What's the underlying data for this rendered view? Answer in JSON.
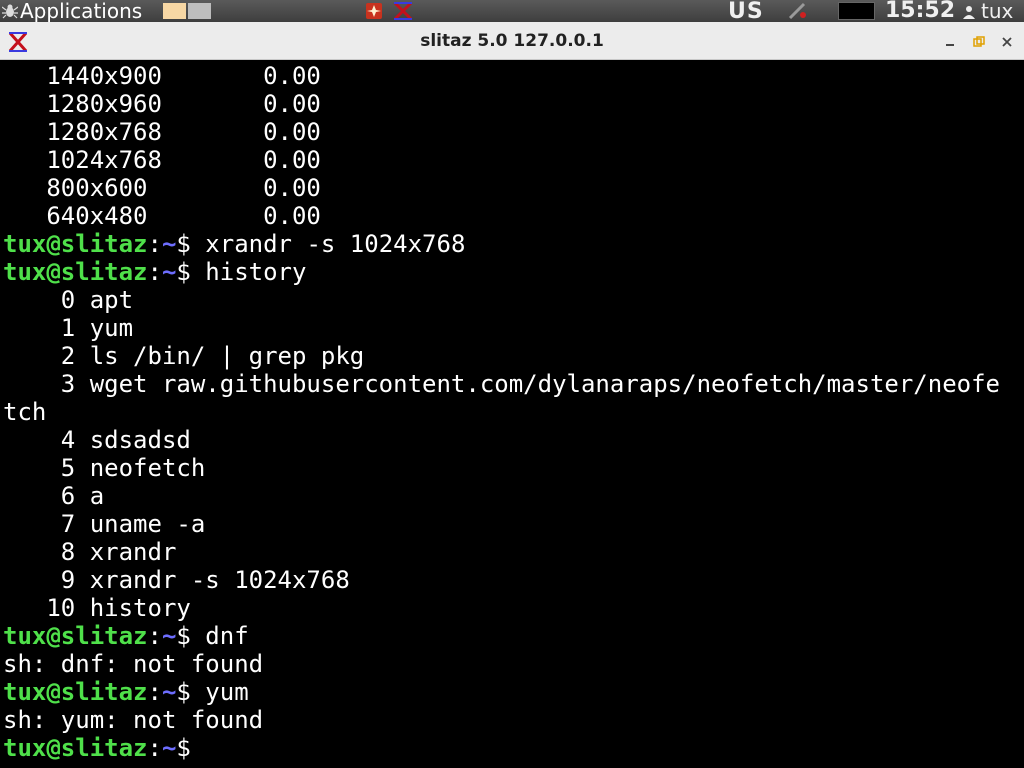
{
  "panel": {
    "applications_label": "Applications",
    "keyboard_layout": "US",
    "clock": "15:52",
    "user": "tux",
    "icons": [
      "spider-icon",
      "workspace-1",
      "workspace-2",
      "task-icon",
      "tazpanel-icon",
      "network-icon",
      "user-icon"
    ]
  },
  "window": {
    "title": "slitaz 5.0 127.0.0.1"
  },
  "terminal": {
    "prompt_user": "tux@slitaz",
    "prompt_colon": ":",
    "prompt_path": "~",
    "prompt_dollar": "$",
    "lines": [
      "   1440x900       0.00",
      "   1280x960       0.00",
      "   1280x768       0.00",
      "   1024x768       0.00",
      "   800x600        0.00",
      "   640x480        0.00",
      {
        "cmd": " xrandr -s 1024x768"
      },
      {
        "cmd": " history"
      },
      "    0 apt",
      "    1 yum",
      "    2 ls /bin/ | grep pkg",
      "    3 wget raw.githubusercontent.com/dylanaraps/neofetch/master/neofe",
      "tch",
      "    4 sdsadsd",
      "    5 neofetch",
      "    6 a",
      "    7 uname -a",
      "    8 xrandr",
      "    9 xrandr -s 1024x768",
      "   10 history",
      {
        "cmd": " dnf"
      },
      "sh: dnf: not found",
      {
        "cmd": " yum"
      },
      "sh: yum: not found",
      {
        "cmd": ""
      }
    ]
  },
  "colors": {
    "prompt_user": "#4fe04a",
    "prompt_path": "#6d6dff",
    "terminal_bg": "#000000",
    "terminal_fg": "#ffffff"
  }
}
